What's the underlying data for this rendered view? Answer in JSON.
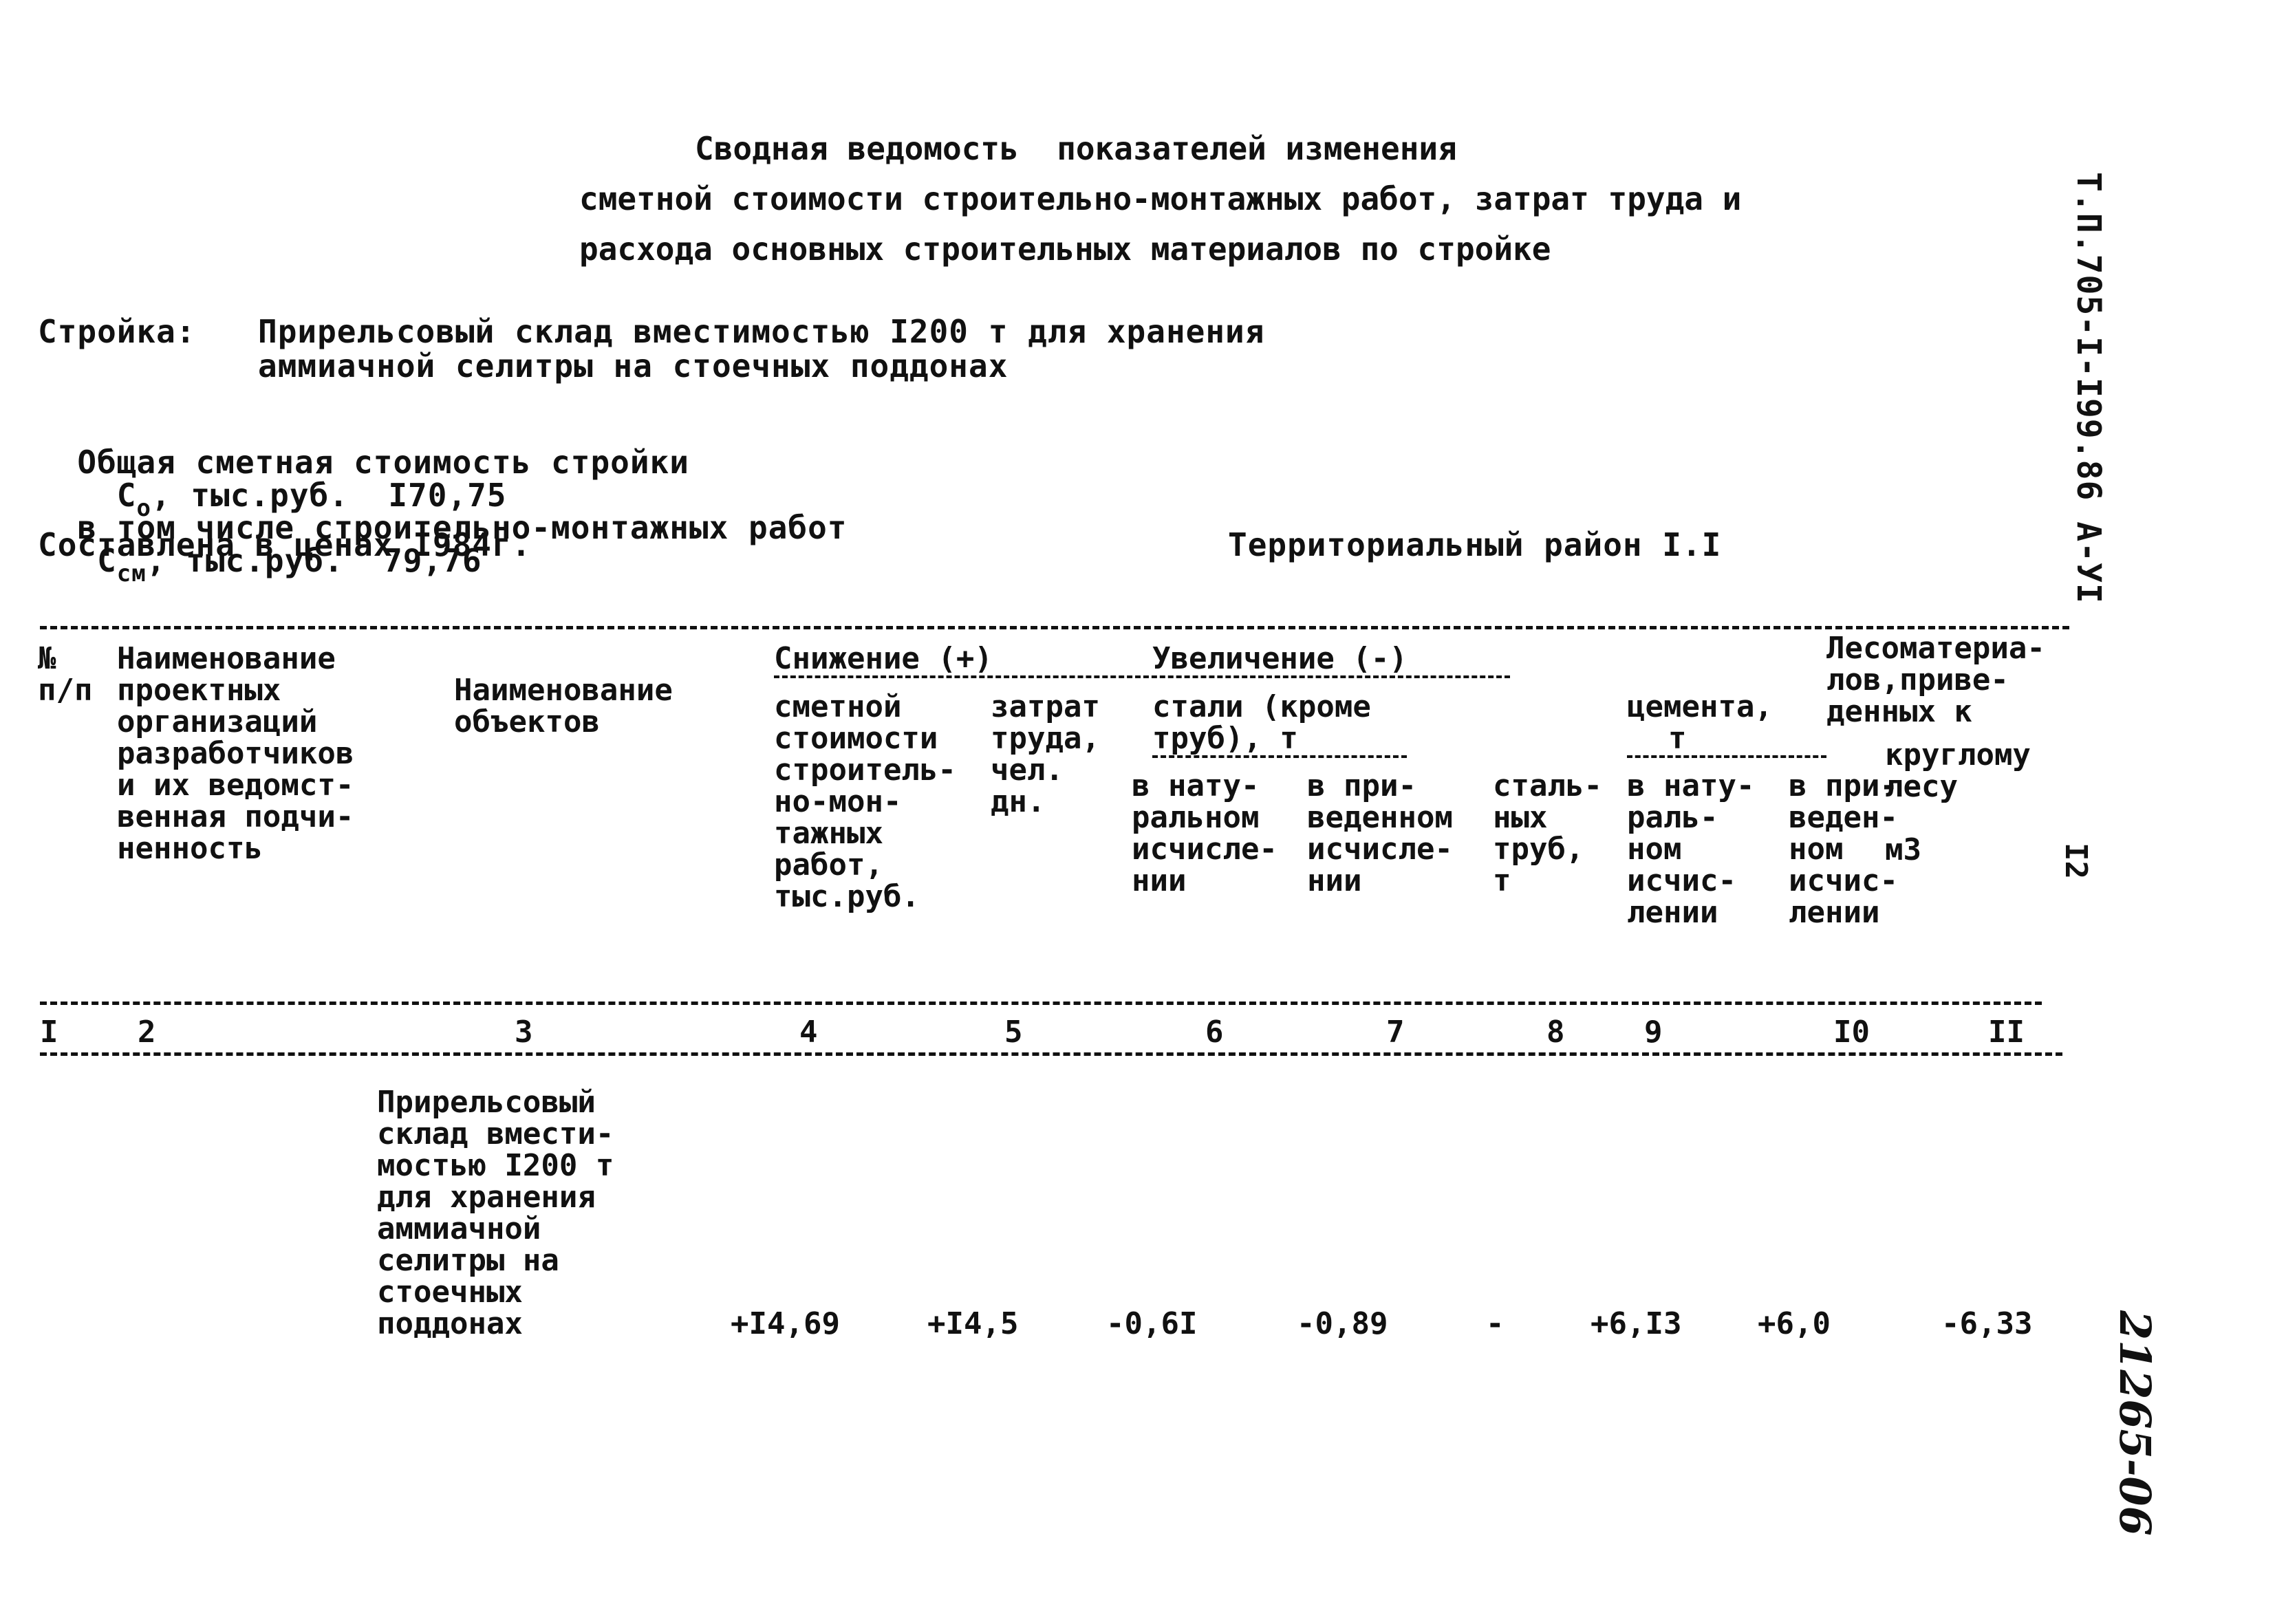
{
  "title": {
    "line1": "Сводная ведомость  показателей изменения",
    "line2": "сметной стоимости строительно-монтажных работ, затрат труда и",
    "line3": "расхода основных строительных материалов по стройке"
  },
  "doc_code": "Т.П.705-I-I99.86 А-УI",
  "page_number": "I2",
  "handwritten_code": "21265-06",
  "project": {
    "label": "Стройка:",
    "name_line1": "Прирельсовый склад вместимостью I200 т для хранения",
    "name_line2": "аммиачной селитры на стоечных поддонах"
  },
  "totals": {
    "total_label": "Общая сметная стоимость стройки",
    "total_symbol": "С",
    "total_symbol_sub": "о",
    "total_unit": ", тыс.руб.",
    "total_value": "I70,75",
    "smr_label": "в том числе строительно-монтажных работ",
    "smr_symbol": "С",
    "smr_symbol_sub": "см",
    "smr_unit": ", тыс.руб.",
    "smr_value": "79,76",
    "prices_label": "Составлена в ценах I984г.",
    "region_label": "Территориальный район I.I"
  },
  "table": {
    "group_header_decrease": "Снижение (+)",
    "group_header_increase": "Увеличение (-)",
    "columns": [
      {
        "num": "I",
        "header": "№\nп/п"
      },
      {
        "num": "2",
        "header": "Наименование\nпроектных\nорганизаций\nразработчиков\nи их ведомст-\nвенная подчи-\nненность"
      },
      {
        "num": "3",
        "header": "Наименование\nобъектов"
      },
      {
        "num": "4",
        "header": "сметной\nстоимости\nстроитель-\nно-мон-\nтажных\nработ,\nтыс.руб."
      },
      {
        "num": "5",
        "header": "затрат\nтруда,\nчел.\nдн."
      },
      {
        "num": "6",
        "header": "в нату-\nральном\nисчисле-\nнии"
      },
      {
        "num": "7",
        "header": "в при-\nведенном\nисчисле-\nнии"
      },
      {
        "num": "8",
        "header": "сталь-\nных\nтруб,\n  т"
      },
      {
        "num": "9",
        "header": "в нату-\nраль-\nном\nисчис-\nлении"
      },
      {
        "num": "I0",
        "header": "в при-\nведен-\nном\nисчис-\nлении"
      },
      {
        "num": "II",
        "header": "  круглому\n   лесу\n\n    м3"
      }
    ],
    "steel_group_header_line1": "стали (кроме",
    "steel_group_header_line2": "труб), т",
    "cement_group_header_line1": "цемента,",
    "cement_group_header_line2": "т",
    "timber_group_header": "Лесоматериа-\nлов,приве-\nденных к",
    "rows": [
      {
        "col1": "",
        "col2": "",
        "col3": "Прирельсовый\nсклад вмести-\nмостью I200 т\nдля хранения\nаммиачной\nселитры на\nстоечных\nподдонах",
        "col4": "+I4,69",
        "col5": "+I4,5",
        "col6": "-0,6I",
        "col7": "-0,89",
        "col8": "-",
        "col9": "+6,I3",
        "col10": "+6,0",
        "col11": "-6,33"
      }
    ]
  }
}
